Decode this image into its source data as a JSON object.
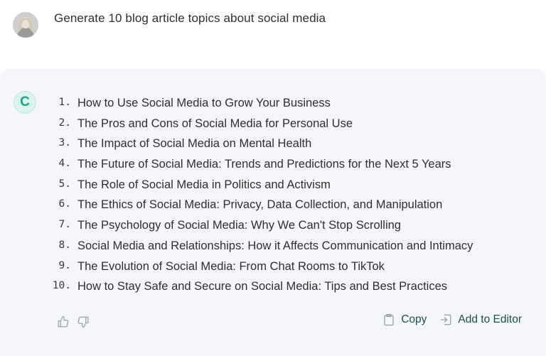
{
  "prompt": {
    "avatar_icon": "user-avatar-photo",
    "text": "Generate 10 blog article topics about social media"
  },
  "response": {
    "bot_avatar_letter": "C",
    "accent_color": "#1aa58a",
    "topics": [
      {
        "number": "1.",
        "text": "How to Use Social Media to Grow Your Business"
      },
      {
        "number": "2.",
        "text": "The Pros and Cons of Social Media for Personal Use"
      },
      {
        "number": "3.",
        "text": "The Impact of Social Media on Mental Health"
      },
      {
        "number": "4.",
        "text": "The Future of Social Media: Trends and Predictions for the Next 5 Years"
      },
      {
        "number": "5.",
        "text": "The Role of Social Media in Politics and Activism"
      },
      {
        "number": "6.",
        "text": "The Ethics of Social Media: Privacy, Data Collection, and Manipulation"
      },
      {
        "number": "7.",
        "text": "The Psychology of Social Media: Why We Can't Stop Scrolling"
      },
      {
        "number": "8.",
        "text": "Social Media and Relationships: How it Affects Communication and Intimacy"
      },
      {
        "number": "9.",
        "text": "The Evolution of Social Media: From Chat Rooms to TikTok"
      },
      {
        "number": "10.",
        "text": "How to Stay Safe and Secure on Social Media: Tips and Best Practices"
      }
    ],
    "feedback": {
      "like_icon": "thumbs-up-icon",
      "dislike_icon": "thumbs-down-icon"
    },
    "actions": {
      "copy_label": "Copy",
      "copy_icon": "clipboard-icon",
      "add_to_editor_label": "Add to Editor",
      "add_to_editor_icon": "login-arrow-icon"
    }
  }
}
